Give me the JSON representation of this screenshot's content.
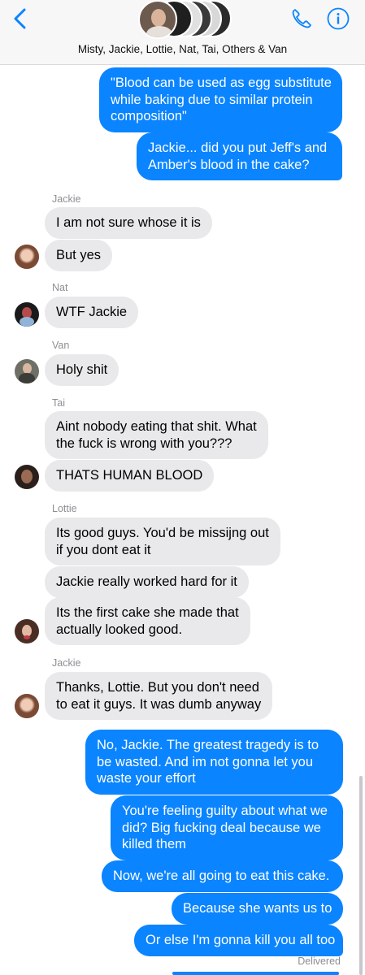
{
  "header": {
    "title": "Misty, Jackie, Lottie, Nat, Tai, Others & Van",
    "back_icon": "chevron-left-icon",
    "phone_icon": "phone-icon",
    "info_icon": "info-icon",
    "accent": "#0a84ff"
  },
  "messages": [
    {
      "id": "m1",
      "dir": "out",
      "lines": [
        "\"Blood can be used as egg substitute",
        "while baking due to similar protein",
        "composition\""
      ]
    },
    {
      "id": "m2",
      "dir": "out",
      "lines": [
        "Jackie... did you put Jeff's and",
        "Amber's blood in the cake?"
      ]
    },
    {
      "id": "m3",
      "dir": "in",
      "sender": "Jackie",
      "lines": [
        "I am not sure whose it is"
      ]
    },
    {
      "id": "m4",
      "dir": "in",
      "lines": [
        "But yes"
      ]
    },
    {
      "id": "m5",
      "dir": "in",
      "sender": "Nat",
      "lines": [
        "WTF Jackie"
      ]
    },
    {
      "id": "m6",
      "dir": "in",
      "sender": "Van",
      "lines": [
        "Holy shit"
      ]
    },
    {
      "id": "m7",
      "dir": "in",
      "sender": "Tai",
      "lines": [
        "Aint nobody eating that shit. What",
        "the fuck is wrong with you???"
      ]
    },
    {
      "id": "m8",
      "dir": "in",
      "lines": [
        "THATS HUMAN BLOOD"
      ]
    },
    {
      "id": "m9",
      "dir": "in",
      "sender": "Lottie",
      "lines": [
        "Its good guys. You'd be missijng out",
        "if you dont eat it"
      ]
    },
    {
      "id": "m10",
      "dir": "in",
      "lines": [
        "Jackie really worked hard for it"
      ]
    },
    {
      "id": "m11",
      "dir": "in",
      "lines": [
        "Its the first cake she made that",
        "actually looked good."
      ]
    },
    {
      "id": "m12",
      "dir": "in",
      "sender": "Jackie",
      "lines": [
        "Thanks, Lottie. But you don't need",
        "to eat it guys. It was dumb anyway"
      ]
    },
    {
      "id": "m13",
      "dir": "out",
      "lines": [
        "No, Jackie. The greatest tragedy is to",
        "be wasted. And im not gonna let you",
        "waste your effort"
      ]
    },
    {
      "id": "m14",
      "dir": "out",
      "lines": [
        "You're feeling guilty about what we",
        "did? Big fucking deal because we",
        "killed them"
      ]
    },
    {
      "id": "m15",
      "dir": "out",
      "lines": [
        "Now, we're all going to eat this cake."
      ]
    },
    {
      "id": "m16",
      "dir": "out",
      "lines": [
        "Because she wants us to"
      ]
    },
    {
      "id": "m17",
      "dir": "out",
      "lines": [
        "Or else I'm gonna kill you all too"
      ]
    }
  ],
  "status": "Delivered"
}
